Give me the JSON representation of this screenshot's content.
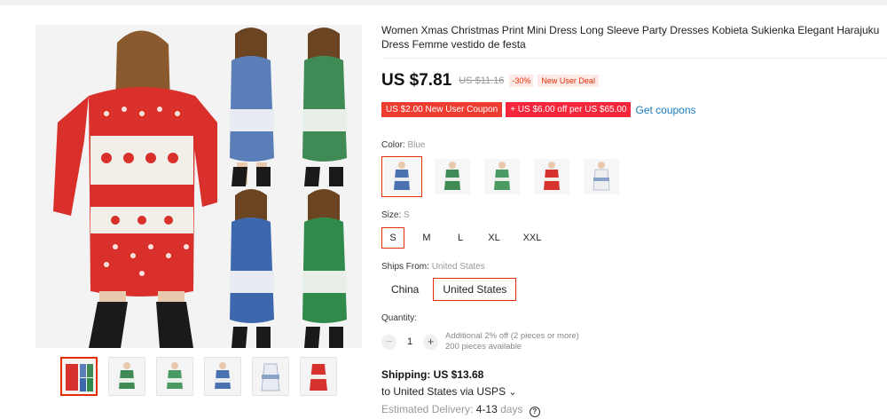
{
  "product": {
    "title": "Women Xmas Christmas Print Mini Dress Long Sleeve Party Dresses Kobieta Sukienka Elegant Harajuku Dress Femme vestido de festa"
  },
  "price": {
    "current": "US $7.81",
    "original": "US $11.16",
    "discount": "-30%",
    "deal_badge": "New User Deal"
  },
  "coupons": {
    "items": [
      "US $2.00 New User Coupon",
      "+ US $6.00 off per US $65.00"
    ],
    "get_label": "Get coupons"
  },
  "color": {
    "label": "Color:",
    "selected": "Blue",
    "options": [
      {
        "name": "blue",
        "hex": "#4a72b0"
      },
      {
        "name": "green",
        "hex": "#3f8a55"
      },
      {
        "name": "green-light",
        "hex": "#4c9a63"
      },
      {
        "name": "red",
        "hex": "#d8322f"
      },
      {
        "name": "white",
        "hex": "#eeeeee"
      }
    ]
  },
  "size": {
    "label": "Size:",
    "selected": "S",
    "options": [
      "S",
      "M",
      "L",
      "XL",
      "XXL"
    ]
  },
  "ships_from": {
    "label": "Ships From:",
    "selected": "United States",
    "options": [
      "China",
      "United States"
    ]
  },
  "quantity": {
    "label": "Quantity:",
    "value": "1",
    "minus": "−",
    "plus": "+",
    "info_line1": "Additional 2% off (2 pieces or more)",
    "info_line2": "200 pieces available"
  },
  "shipping": {
    "cost": "Shipping: US $13.68",
    "destination": "to United States via USPS",
    "chevron": "⌄",
    "delivery_label": "Estimated Delivery:",
    "delivery_value": "4-13",
    "delivery_unit": "days",
    "help": "?"
  },
  "colors": {
    "accent": "#e62e04",
    "coupon": "#f03d32",
    "link": "#1a7bbf",
    "red_dress": "#d8322f",
    "blue_dress": "#4a72b0",
    "green_dress": "#3f8a55"
  },
  "gallery": {
    "thumbnails": [
      "red",
      "green",
      "green-light",
      "blue",
      "white",
      "red-back"
    ]
  }
}
